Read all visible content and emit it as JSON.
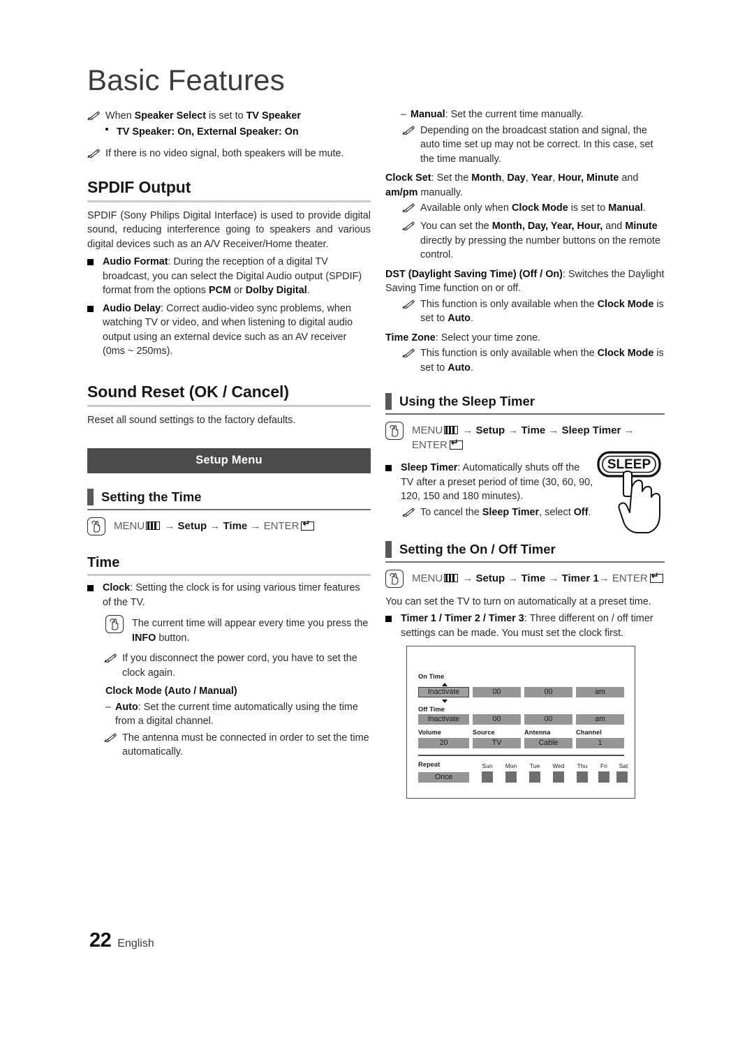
{
  "document": {
    "title": "Basic Features",
    "page_number": "22",
    "language": "English"
  },
  "left_column": {
    "notes_top": [
      {
        "icon": "pencil-note-icon",
        "segments": [
          {
            "t": "When ",
            "b": false
          },
          {
            "t": "Speaker Select",
            "b": true
          },
          {
            "t": " is set to ",
            "b": false
          },
          {
            "t": "TV Speaker",
            "b": true
          }
        ]
      }
    ],
    "bullet_top": "TV Speaker: On, External Speaker: On",
    "note_mute": "If there is no video signal, both speakers will be mute.",
    "spdif": {
      "heading": "SPDIF Output",
      "intro": "SPDIF (Sony Philips Digital Interface) is used to provide digital sound, reducing interference going to speakers and various digital devices such as an A/V Receiver/Home theater.",
      "items": [
        {
          "label": "Audio Format",
          "text": ": During the reception of a digital TV broadcast, you can select the Digital Audio output (SPDIF) format from the options ",
          "bold_tail": "PCM",
          "mid": " or ",
          "bold_tail2": "Dolby Digital",
          "end": "."
        },
        {
          "label": "Audio Delay",
          "text": ": Correct audio-video sync problems, when watching TV or video, and when listening to digital audio output using an external device such as an AV receiver (0ms ~ 250ms).",
          "bold_tail": "",
          "mid": "",
          "bold_tail2": "",
          "end": ""
        }
      ]
    },
    "sound_reset": {
      "heading": "Sound Reset (OK / Cancel)",
      "text": "Reset all sound settings to the factory defaults."
    },
    "setup_menu_banner": "Setup Menu",
    "setting_the_time": {
      "heading": "Setting the Time",
      "path": [
        "MENU",
        "Setup",
        "Time",
        "ENTER"
      ]
    },
    "time": {
      "heading": "Time",
      "clock_label": "Clock",
      "clock_text": ": Setting the clock is for using various timer features of the TV.",
      "info_note": "The current time will appear every time you press the INFO button.",
      "info_note_pre": "The current time will appear every time you press the ",
      "info_note_bold": "INFO",
      "info_note_post": " button.",
      "power_note": "If you disconnect the power cord, you have to set the clock again.",
      "clock_mode_heading": "Clock Mode (Auto / Manual)",
      "auto_label": "Auto",
      "auto_text": ": Set the current time automatically using the time from a digital channel.",
      "antenna_note": "The antenna must be connected in order to set the time automatically."
    }
  },
  "right_column": {
    "manual_label": "Manual",
    "manual_text": ": Set the current time manually.",
    "broadcast_note": "Depending on the broadcast station and signal, the auto time set up may not be correct. In this case, set the time manually.",
    "clock_set": {
      "label": "Clock Set",
      "pre": ": Set the ",
      "fields": "Month, Day, Year, Hour, Minute",
      "post": " and am/pm manually.",
      "post_plain": " and ",
      "post_bold": "am/pm",
      "post_tail": " manually."
    },
    "clock_set_note1_pre": "Available only when ",
    "clock_set_note1_bold": "Clock Mode",
    "clock_set_note1_mid": " is set to ",
    "clock_set_note1_bold2": "Manual",
    "clock_set_note1_end": ".",
    "clock_set_note2_pre": "You can set the ",
    "clock_set_note2_bold": "Month, Day, Year, Hour,",
    "clock_set_note2_mid": " and ",
    "clock_set_note2_bold2": "Minute",
    "clock_set_note2_end": " directly by pressing the number buttons on the remote control.",
    "dst": {
      "label": "DST (Daylight Saving Time) (Off / On)",
      "text": ": Switches the Daylight Saving Time function on or off.",
      "note_pre": "This function is only available when the ",
      "note_bold": "Clock Mode",
      "note_mid": " is set to ",
      "note_bold2": "Auto",
      "note_end": "."
    },
    "time_zone": {
      "label": "Time Zone",
      "text": ": Select your time zone.",
      "note_pre": "This function is only available when the ",
      "note_bold": "Clock Mode",
      "note_mid": " is set to ",
      "note_bold2": "Auto",
      "note_end": "."
    },
    "sleep_timer": {
      "heading": "Using the Sleep Timer",
      "path": [
        "MENU",
        "Setup",
        "Time",
        "Sleep Timer",
        "ENTER"
      ],
      "item_label": "Sleep Timer",
      "item_text": ": Automatically shuts off the TV after a preset period of time (30, 60, 90, 120, 150 and 180 minutes).",
      "cancel_note_pre": "To cancel the ",
      "cancel_note_bold": "Sleep Timer",
      "cancel_note_mid": ", select ",
      "cancel_note_bold2": "Off",
      "cancel_note_end": ".",
      "remote_button_label": "SLEEP"
    },
    "on_off_timer": {
      "heading": "Setting the On / Off Timer",
      "path": [
        "MENU",
        "Setup",
        "Time",
        "Timer 1",
        "ENTER"
      ],
      "intro": "You can set the TV to turn on automatically at a preset time.",
      "item_label": "Timer 1 / Timer 2 / Timer 3",
      "item_text": ": Three different on / off timer settings can be made. You must set the clock first."
    }
  },
  "timer_figure": {
    "on_time_label": "On Time",
    "off_time_label": "Off Time",
    "on_time_values": [
      "Inactivate",
      "00",
      "00",
      "am"
    ],
    "off_time_values": [
      "Inactivate",
      "00",
      "00",
      "am"
    ],
    "field_labels": [
      "Volume",
      "Source",
      "Antenna",
      "Channel"
    ],
    "field_values": [
      "20",
      "TV",
      "Cable",
      "1"
    ],
    "repeat_label": "Repeat",
    "repeat_value": "Once",
    "days": [
      "Sun",
      "Mon",
      "Tue",
      "Wed",
      "Thu",
      "Fri",
      "Sat"
    ]
  },
  "colors": {
    "banner": "#4b4b4b",
    "rule": "#c9c9c9",
    "bar": "#58585a",
    "cell": "#969696",
    "daybox": "#6e6e6e"
  }
}
